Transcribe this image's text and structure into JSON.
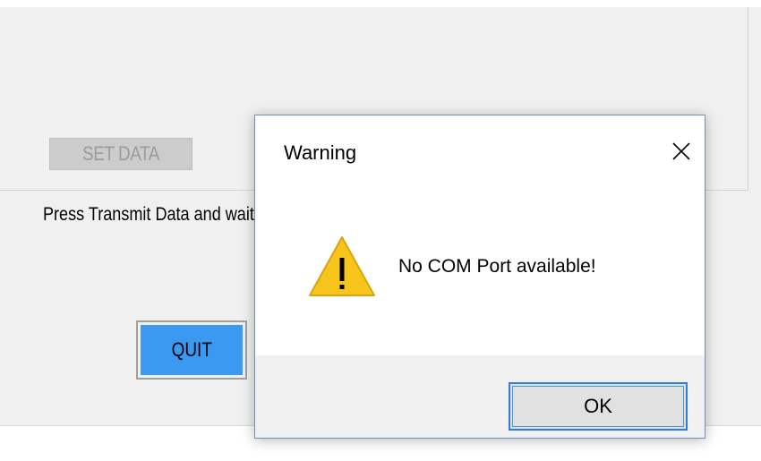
{
  "app": {
    "set_data_label": "SET DATA",
    "status_text": "Press Transmit Data and wait until the data is transmitted",
    "quit_label": "QUIT"
  },
  "dialog": {
    "title": "Warning",
    "message": "No COM Port available!",
    "ok_label": "OK",
    "icon": "warning-icon",
    "close_icon": "close-icon"
  },
  "colors": {
    "quit_button_fill": "#3b99f2",
    "ok_button_border": "#2f7fd8",
    "warning_yellow": "#f7c41b"
  }
}
